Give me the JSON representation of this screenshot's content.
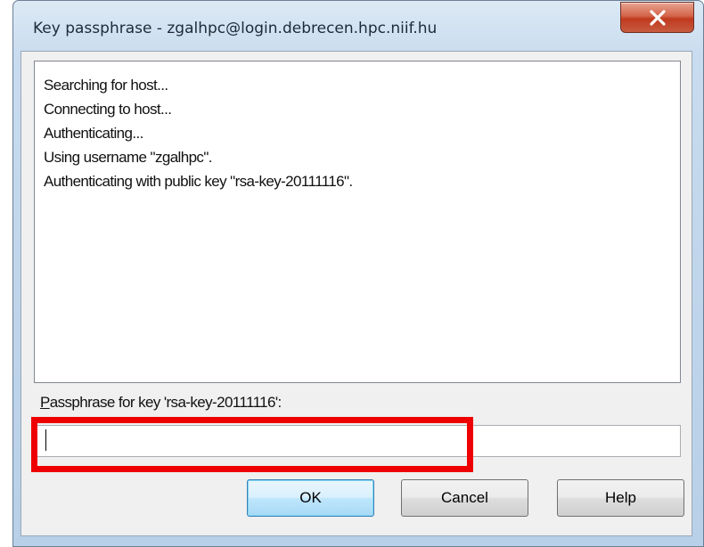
{
  "window": {
    "title": "Key passphrase - zgalhpc@login.debrecen.hpc.niif.hu",
    "close_icon": "close-icon"
  },
  "log": {
    "lines": [
      "Searching for host...",
      "Connecting to host...",
      "Authenticating...",
      "Using username \"zgalhpc\".",
      "Authenticating with public key \"rsa-key-20111116\"."
    ]
  },
  "passphrase": {
    "label": "Passphrase for key 'rsa-key-20111116':",
    "value": ""
  },
  "buttons": {
    "ok": "OK",
    "cancel": "Cancel",
    "help": "Help"
  },
  "colors": {
    "highlight": "#ee0000",
    "close_button": "#c13a1e",
    "default_button_border": "#3c7fb1"
  }
}
